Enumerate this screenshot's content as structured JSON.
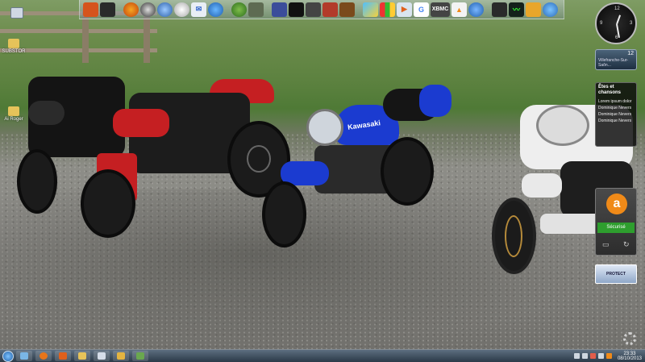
{
  "desktop": {
    "icons": [
      {
        "label": "",
        "icon": "computer-icon"
      },
      {
        "label": "SUBSTOR",
        "icon": "folder-icon"
      },
      {
        "label": "Ai Roger",
        "icon": "folder-icon"
      }
    ]
  },
  "quick_launch": {
    "icons": [
      "sticker-icon",
      "media-icon",
      "firefox-icon",
      "game-icon",
      "globe-icon",
      "photo-icon",
      "mail-icon",
      "edge-icon",
      "leaf-icon",
      "gallery-icon",
      "disk-icon",
      "wave-icon",
      "tools-icon",
      "camera-icon",
      "book-icon",
      "image-icon",
      "office-icon",
      "play-icon",
      "google-icon",
      "xbmc-icon",
      "vlc-icon",
      "spotify-icon",
      "tool-icon",
      "monitor-icon",
      "fold-icon",
      "ie-icon"
    ],
    "xbmc_label": "XBMC"
  },
  "gadgets": {
    "clock": {
      "numerals": [
        "12",
        "3",
        "6",
        "9"
      ]
    },
    "weather": {
      "temperature": "12",
      "location": "Villefranche-Sur-Saôn..."
    },
    "feed": {
      "title": "Êtes et chansons",
      "items": [
        "Lorem ipsum dolor",
        "Dominique Nevers",
        "Dominique Nevers",
        "Dominique Nevers"
      ]
    },
    "avast": {
      "status": "Sécurisé",
      "logo": "a"
    },
    "recycle": {
      "label": "PROTECT"
    }
  },
  "taskbar": {
    "apps": [
      "explorer-icon",
      "firefox-icon",
      "media-icon",
      "folder-icon",
      "document-icon",
      "explorer2-icon",
      "settings-icon"
    ],
    "clock_time": "23:33",
    "clock_date": "08/10/2013"
  },
  "colors": {
    "kawasaki_blue": "#1b3bd0",
    "ducati_red": "#c51f22",
    "avast_orange": "#f08a18",
    "avast_green": "#2e9e2e"
  },
  "bikes": [
    "black-sportbike",
    "red-ducati",
    "blue-kawasaki",
    "white-naked-bike"
  ],
  "brand_text": "Kawasaki"
}
